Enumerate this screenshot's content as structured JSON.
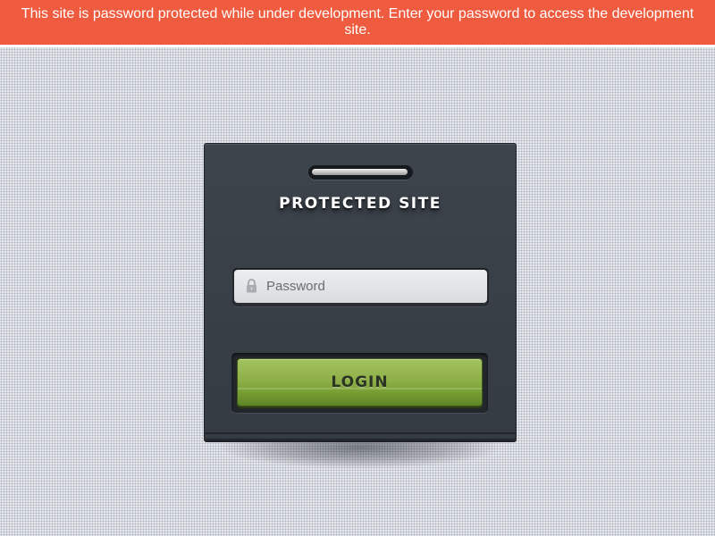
{
  "banner": {
    "message": "This site is password protected while under development. Enter your password to access the development site."
  },
  "login_card": {
    "title": "PROTECTED SITE",
    "password_field": {
      "placeholder": "Password",
      "value": ""
    },
    "login_button_label": "LOGIN"
  },
  "colors": {
    "banner": "#ef5b3f",
    "card": "#3a4048",
    "button": "#8fb049",
    "page_background": "#e3e5ea"
  },
  "icons": {
    "field_icon": "lock-icon",
    "hanger": "hanger-icon"
  }
}
